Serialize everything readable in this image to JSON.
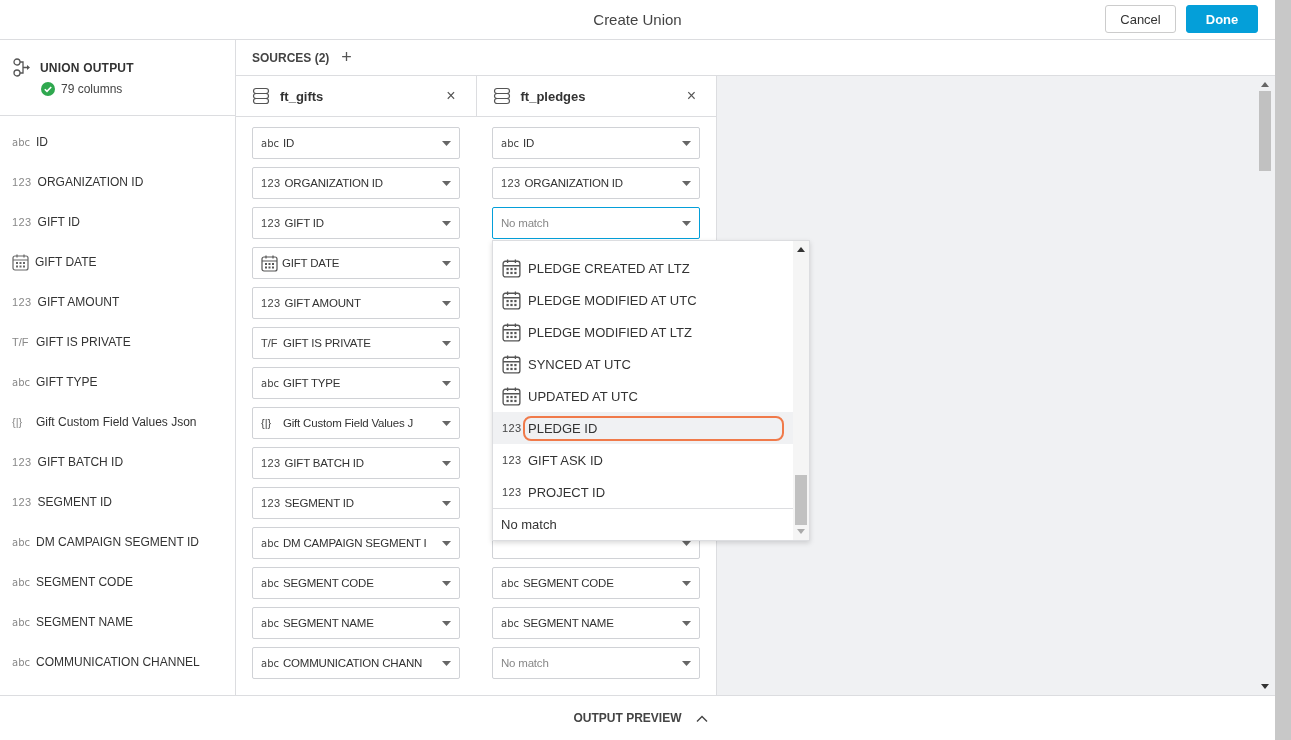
{
  "window": {
    "title": "Create Union"
  },
  "buttons": {
    "cancel": "Cancel",
    "done": "Done"
  },
  "output": {
    "title": "UNION OUTPUT",
    "status": "79 columns"
  },
  "sources": {
    "label": "SOURCES (2)",
    "add": "+",
    "tabs": [
      {
        "name": "ft_gifts",
        "close": "×"
      },
      {
        "name": "ft_pledges",
        "close": "×"
      }
    ]
  },
  "rows": [
    {
      "output": {
        "name": "ID",
        "kind": "text",
        "type_label": "abc"
      },
      "gifts": {
        "value": "ID",
        "kind": "text",
        "type_label": "abc",
        "matched": true
      },
      "pledges": {
        "value": "ID",
        "kind": "text",
        "type_label": "abc",
        "matched": true,
        "focused": false
      }
    },
    {
      "output": {
        "name": "ORGANIZATION ID",
        "kind": "number",
        "type_label": "123"
      },
      "gifts": {
        "value": "ORGANIZATION ID",
        "kind": "number",
        "type_label": "123",
        "matched": true
      },
      "pledges": {
        "value": "ORGANIZATION ID",
        "kind": "number",
        "type_label": "123",
        "matched": true,
        "focused": false
      }
    },
    {
      "output": {
        "name": "GIFT ID",
        "kind": "number",
        "type_label": "123"
      },
      "gifts": {
        "value": "GIFT ID",
        "kind": "number",
        "type_label": "123",
        "matched": true
      },
      "pledges": {
        "placeholder": "No match",
        "matched": false,
        "focused": true
      }
    },
    {
      "output": {
        "name": "GIFT DATE",
        "kind": "date"
      },
      "gifts": {
        "value": "GIFT DATE",
        "kind": "date",
        "matched": true
      }
    },
    {
      "output": {
        "name": "GIFT AMOUNT",
        "kind": "number",
        "type_label": "123"
      },
      "gifts": {
        "value": "GIFT AMOUNT",
        "kind": "number",
        "type_label": "123",
        "matched": true
      }
    },
    {
      "output": {
        "name": "GIFT IS PRIVATE",
        "kind": "boolean",
        "type_label": "T/F"
      },
      "gifts": {
        "value": "GIFT IS PRIVATE",
        "kind": "boolean",
        "type_label": "T/F",
        "matched": true
      }
    },
    {
      "output": {
        "name": "GIFT TYPE",
        "kind": "text",
        "type_label": "abc"
      },
      "gifts": {
        "value": "GIFT TYPE",
        "kind": "text",
        "type_label": "abc",
        "matched": true
      }
    },
    {
      "output": {
        "name": "Gift Custom Field Values Json",
        "kind": "json",
        "type_label": "{|}"
      },
      "gifts": {
        "value": "Gift Custom Field Values J",
        "kind": "json",
        "type_label": "{|}",
        "matched": true
      }
    },
    {
      "output": {
        "name": "GIFT BATCH ID",
        "kind": "number",
        "type_label": "123"
      },
      "gifts": {
        "value": "GIFT BATCH ID",
        "kind": "number",
        "type_label": "123",
        "matched": true
      }
    },
    {
      "output": {
        "name": "SEGMENT ID",
        "kind": "number",
        "type_label": "123"
      },
      "gifts": {
        "value": "SEGMENT ID",
        "kind": "number",
        "type_label": "123",
        "matched": true
      }
    },
    {
      "output": {
        "name": "DM CAMPAIGN SEGMENT ID",
        "kind": "text",
        "type_label": "abc"
      },
      "gifts": {
        "value": "DM CAMPAIGN SEGMENT I",
        "kind": "text",
        "type_label": "abc",
        "matched": true
      },
      "pledges": {
        "focused": false
      }
    },
    {
      "output": {
        "name": "SEGMENT CODE",
        "kind": "text",
        "type_label": "abc"
      },
      "gifts": {
        "value": "SEGMENT CODE",
        "kind": "text",
        "type_label": "abc",
        "matched": true
      },
      "pledges": {
        "value": "SEGMENT CODE",
        "kind": "text",
        "type_label": "abc",
        "matched": true,
        "focused": false
      }
    },
    {
      "output": {
        "name": "SEGMENT NAME",
        "kind": "text",
        "type_label": "abc"
      },
      "gifts": {
        "value": "SEGMENT NAME",
        "kind": "text",
        "type_label": "abc",
        "matched": true
      },
      "pledges": {
        "value": "SEGMENT NAME",
        "kind": "text",
        "type_label": "abc",
        "matched": true,
        "focused": false
      }
    },
    {
      "output": {
        "name": "COMMUNICATION CHANNEL",
        "kind": "text",
        "type_label": "abc"
      },
      "gifts": {
        "value": "COMMUNICATION CHANN",
        "kind": "text",
        "type_label": "abc",
        "matched": true
      },
      "pledges": {
        "placeholder": "No match",
        "matched": false,
        "focused": false
      }
    }
  ],
  "dropdown": {
    "items": [
      {
        "label": "PLEDGE CREATED AT LTZ",
        "kind": "date",
        "highlighted": false
      },
      {
        "label": "PLEDGE MODIFIED AT UTC",
        "kind": "date",
        "highlighted": false
      },
      {
        "label": "PLEDGE MODIFIED AT LTZ",
        "kind": "date",
        "highlighted": false
      },
      {
        "label": "SYNCED AT UTC",
        "kind": "date",
        "highlighted": false
      },
      {
        "label": "UPDATED AT UTC",
        "kind": "date",
        "highlighted": false
      },
      {
        "label": "PLEDGE ID",
        "kind": "number",
        "type_label": "123",
        "highlighted": true
      },
      {
        "label": "GIFT ASK ID",
        "kind": "number",
        "type_label": "123",
        "highlighted": false
      },
      {
        "label": "PROJECT ID",
        "kind": "number",
        "type_label": "123",
        "highlighted": false
      }
    ],
    "no_match": "No match"
  },
  "footer": {
    "label": "OUTPUT PREVIEW"
  }
}
